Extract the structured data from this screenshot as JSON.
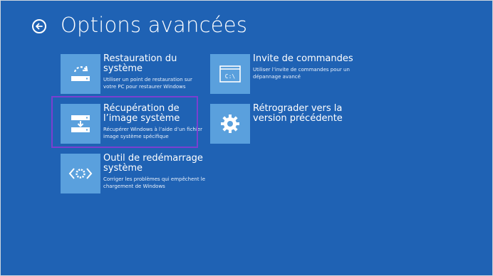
{
  "header": {
    "title": "Options avancées",
    "back_icon": "back-arrow-icon"
  },
  "colors": {
    "background": "#1f62b4",
    "tile": "#5aa0dd",
    "selection": "#7b3fd0"
  },
  "options": [
    {
      "name": "Restauration du système",
      "description": "Utiliser un point de restauration sur votre PC pour restaurer Windows",
      "icon": "system-restore-icon"
    },
    {
      "name": "Récupération de l’image système",
      "description": "Récupérer Windows à l’aide d’un fichier image système spécifique",
      "icon": "system-image-recovery-icon",
      "selected": true
    },
    {
      "name": "Outil de redémarrage système",
      "description": "Corriger les problèmes qui empêchent le chargement de Windows",
      "icon": "startup-repair-icon"
    },
    {
      "name": "Invite de commandes",
      "description": "Utiliser l’invite de commandes pour un dépannage avancé",
      "icon": "command-prompt-icon",
      "icon_text": "C:\\"
    },
    {
      "name": "Rétrograder vers la version précédente",
      "description": "",
      "icon": "gear-icon"
    }
  ]
}
